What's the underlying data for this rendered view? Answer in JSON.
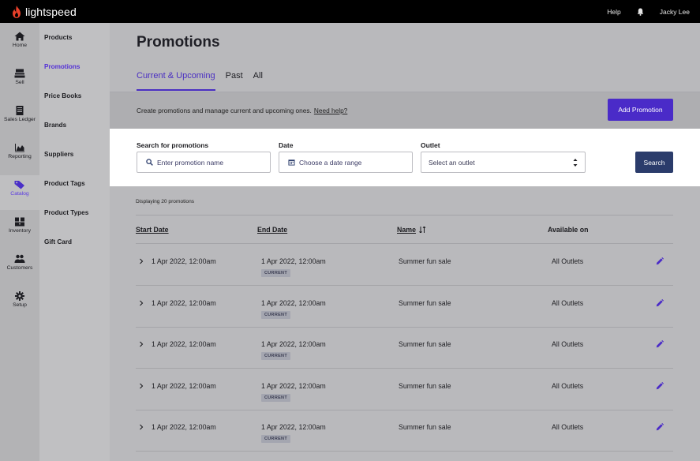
{
  "brand": {
    "name": "lightspeed"
  },
  "topbar": {
    "help": "Help",
    "user": "Jacky Lee"
  },
  "rail": [
    {
      "label": "Home",
      "icon": "home-icon"
    },
    {
      "label": "Sell",
      "icon": "register-icon"
    },
    {
      "label": "Sales Ledger",
      "icon": "ledger-icon"
    },
    {
      "label": "Reporting",
      "icon": "chart-icon"
    },
    {
      "label": "Catalog",
      "icon": "tag-icon",
      "active": true
    },
    {
      "label": "Inventory",
      "icon": "boxes-icon"
    },
    {
      "label": "Customers",
      "icon": "users-icon"
    },
    {
      "label": "Setup",
      "icon": "gear-icon"
    }
  ],
  "subnav": [
    {
      "label": "Products"
    },
    {
      "label": "Promotions",
      "active": true
    },
    {
      "label": "Price Books"
    },
    {
      "label": "Brands"
    },
    {
      "label": "Suppliers"
    },
    {
      "label": "Product Tags"
    },
    {
      "label": "Product Types"
    },
    {
      "label": "Gift Card"
    }
  ],
  "page": {
    "title": "Promotions",
    "tabs": [
      {
        "label": "Current & Upcoming",
        "active": true
      },
      {
        "label": "Past"
      },
      {
        "label": "All"
      }
    ],
    "info_text": "Create promotions and manage current and upcoming ones.",
    "help_link": "Need help?",
    "add_button": "Add Promotion"
  },
  "filters": {
    "search_label": "Search for promotions",
    "search_placeholder": "Enter promotion name",
    "date_label": "Date",
    "date_placeholder": "Choose a date range",
    "outlet_label": "Outlet",
    "outlet_value": "Select an outlet",
    "search_button": "Search"
  },
  "table": {
    "displaying": "Displaying 20 promotions",
    "headers": {
      "start": "Start Date",
      "end": "End Date",
      "name": "Name",
      "available": "Available on"
    },
    "rows": [
      {
        "start": "1 Apr 2022, 12:00am",
        "end": "1 Apr 2022, 12:00am",
        "badge": "CURRENT",
        "name": "Summer fun sale",
        "available": "All Outlets"
      },
      {
        "start": "1 Apr 2022, 12:00am",
        "end": "1 Apr 2022, 12:00am",
        "badge": "CURRENT",
        "name": "Summer fun sale",
        "available": "All Outlets"
      },
      {
        "start": "1 Apr 2022, 12:00am",
        "end": "1 Apr 2022, 12:00am",
        "badge": "CURRENT",
        "name": "Summer fun sale",
        "available": "All Outlets"
      },
      {
        "start": "1 Apr 2022, 12:00am",
        "end": "1 Apr 2022, 12:00am",
        "badge": "CURRENT",
        "name": "Summer fun sale",
        "available": "All Outlets"
      },
      {
        "start": "1 Apr 2022, 12:00am",
        "end": "1 Apr 2022, 12:00am",
        "badge": "CURRENT",
        "name": "Summer fun sale",
        "available": "All Outlets"
      }
    ]
  },
  "colors": {
    "accent": "#4a2bc8",
    "search_button": "#2b3c6b",
    "topbar": "#000000",
    "logo_flame": "#e8402a"
  }
}
